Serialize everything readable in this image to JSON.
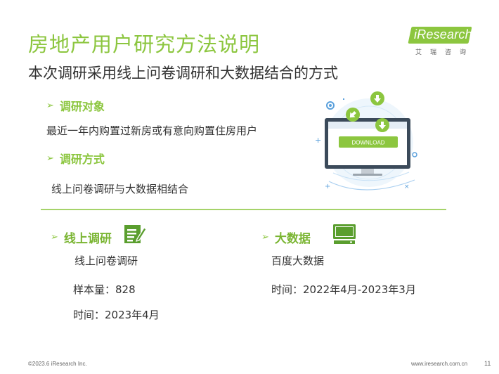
{
  "header": {
    "title": "房地产用户研究方法说明",
    "subtitle": "本次调研采用线上问卷调研和大数据结合的方式"
  },
  "logo": {
    "text": "iResearch",
    "sub": "艾瑞咨询"
  },
  "sections": {
    "target": {
      "label": "调研对象",
      "text": "最近一年内购置过新房或有意向购置住房用户"
    },
    "method": {
      "label": "调研方式",
      "text": "线上问卷调研与大数据相结合"
    }
  },
  "illustration": {
    "button_label": "DOWNLOAD",
    "icon": "computer-download-icon"
  },
  "online": {
    "label": "线上调研",
    "line1": "线上问卷调研",
    "line2": "样本量：828",
    "line3": "时间：2023年4月",
    "icon": "edit-form-icon"
  },
  "bigdata": {
    "label": "大数据",
    "line1": "百度大数据",
    "line2": "时间：2022年4月-2023年3月",
    "icon": "computer-icon"
  },
  "footer": {
    "copyright": "©2023.6 iResearch Inc.",
    "website": "www.iresearch.com.cn",
    "page": "11"
  },
  "colors": {
    "accent": "#8cc63f",
    "text": "#333333",
    "illustration_blue": "#5aa0dc"
  }
}
